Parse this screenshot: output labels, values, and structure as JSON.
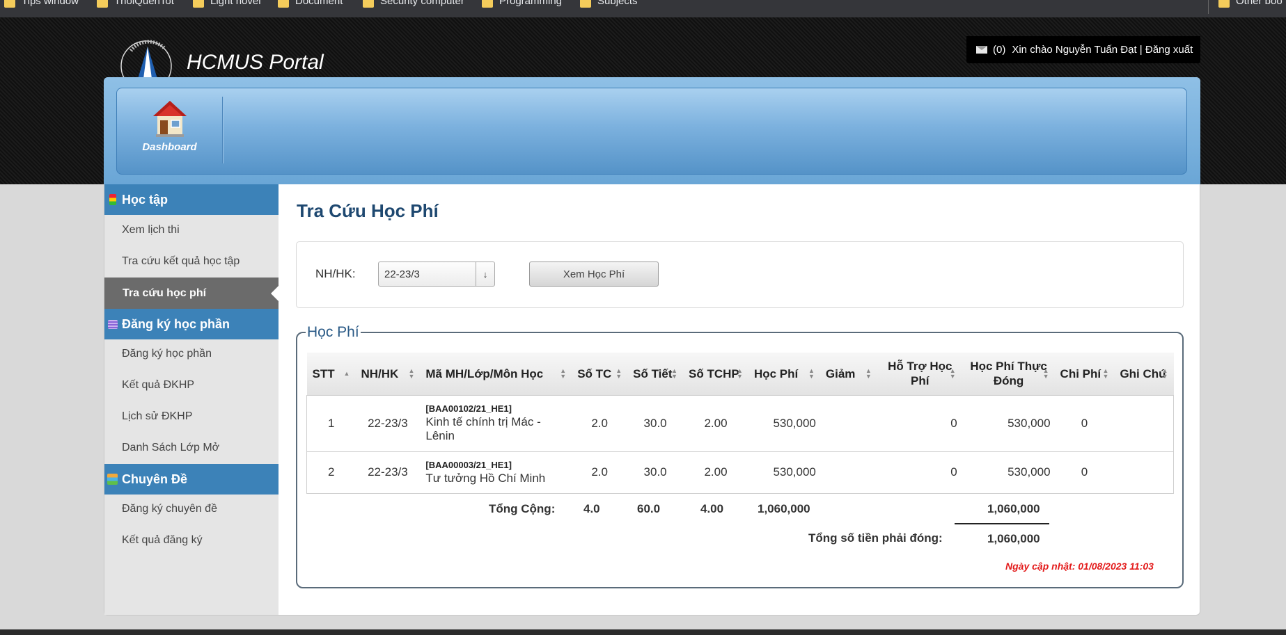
{
  "bookmarks": [
    "Tips window",
    "ThoiQuenTot",
    "Light novel",
    "Document",
    "Security computer",
    "Programming",
    "Subjects",
    "Other boo"
  ],
  "header": {
    "title": "HCMUS Portal",
    "mail_count": "(0)",
    "greeting": "Xin chào Nguyễn Tuấn Đạt | Đăng xuất"
  },
  "nav": {
    "dashboard_label": "Dashboard"
  },
  "sidebar": {
    "sections": [
      {
        "title": "Học tập",
        "items": [
          "Xem lịch thi",
          "Tra cứu kết quả học tập",
          "Tra cứu học phí"
        ]
      },
      {
        "title": "Đăng ký học phần",
        "items": [
          "Đăng ký học phần",
          "Kết quả ĐKHP",
          "Lịch sử ĐKHP",
          "Danh Sách Lớp Mở"
        ]
      },
      {
        "title": "Chuyên Đề",
        "items": [
          "Đăng ký chuyên đề",
          "Kết quả đăng ký"
        ]
      }
    ],
    "active_item": "Tra cứu học phí"
  },
  "page": {
    "title": "Tra Cứu Học Phí",
    "filter_label": "NH/HK:",
    "filter_value": "22-23/3",
    "view_button": "Xem Học Phí",
    "fieldset_legend": "Học Phí"
  },
  "table": {
    "headers": [
      "STT",
      "NH/HK",
      "Mã MH/Lớp/Môn Học",
      "Số TC",
      "Số Tiết",
      "Số TCHP",
      "Học Phí",
      "Giảm",
      "Hỗ Trợ Học Phí",
      "Học Phí Thực Đóng",
      "Chi Phí",
      "Ghi Chú"
    ],
    "rows": [
      {
        "stt": "1",
        "nhhk": "22-23/3",
        "code": "[BAA00102/21_HE1]",
        "name": "Kinh tế chính trị Mác - Lênin",
        "tc": "2.0",
        "tiet": "30.0",
        "tchp": "2.00",
        "hocphi": "530,000",
        "giam": "",
        "hotro": "0",
        "thucdong": "530,000",
        "chiphi": "0",
        "ghichu": ""
      },
      {
        "stt": "2",
        "nhhk": "22-23/3",
        "code": "[BAA00003/21_HE1]",
        "name": "Tư tưởng Hồ Chí Minh",
        "tc": "2.0",
        "tiet": "30.0",
        "tchp": "2.00",
        "hocphi": "530,000",
        "giam": "",
        "hotro": "0",
        "thucdong": "530,000",
        "chiphi": "0",
        "ghichu": ""
      }
    ],
    "totals": {
      "label": "Tổng Cộng:",
      "tc": "4.0",
      "tiet": "60.0",
      "tchp": "4.00",
      "hocphi": "1,060,000",
      "thucdong": "1,060,000"
    },
    "payable_label": "Tổng số tiền phải đóng:",
    "payable_value": "1,060,000",
    "updated": "Ngày cập nhật: 01/08/2023 11:03"
  }
}
